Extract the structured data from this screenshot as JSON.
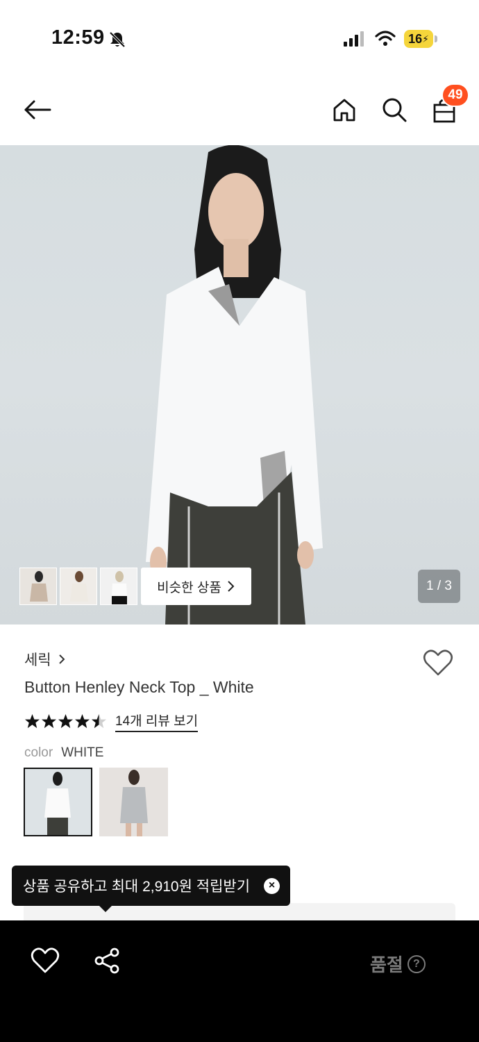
{
  "status_bar": {
    "time": "12:59",
    "battery": "16"
  },
  "header": {
    "cart_count": "49"
  },
  "hero": {
    "similar_button_label": "비슷한 상품",
    "page_indicator": "1 / 3",
    "thumbnail_count": 3
  },
  "product": {
    "brand": "세릭",
    "title": "Button Henley Neck Top _ White",
    "rating": 4.5,
    "review_link": "14개 리뷰 보기",
    "color_label": "color",
    "color_value": "WHITE"
  },
  "tooltip": {
    "text": "상품 공유하고 최대 2,910원 적립받기"
  },
  "bottom_bar": {
    "soldout_label": "품절"
  },
  "colors": {
    "accent": "#ff4f1f",
    "battery": "#f5d53b",
    "bottom_bar": "#000000"
  },
  "icons": [
    "bell-off-icon",
    "signal-icon",
    "wifi-icon",
    "battery-icon",
    "back-arrow-icon",
    "home-icon",
    "search-icon",
    "cart-icon",
    "chevron-right-icon",
    "heart-icon",
    "star-icon",
    "close-icon",
    "share-icon",
    "help-icon"
  ]
}
